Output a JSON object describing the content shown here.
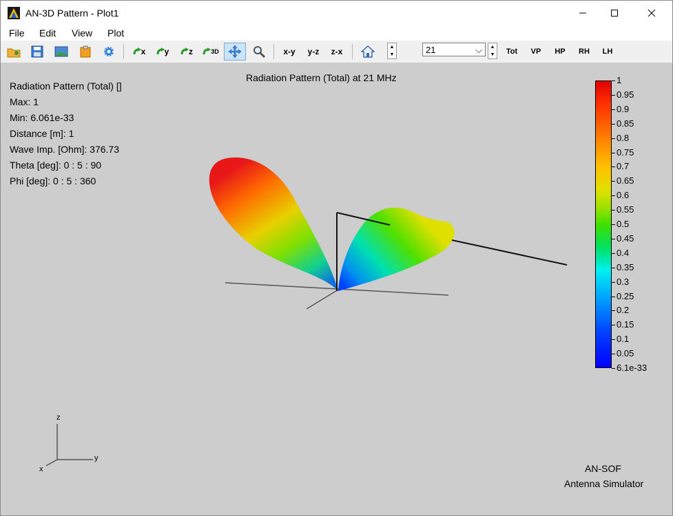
{
  "window": {
    "title": "AN-3D Pattern - Plot1"
  },
  "menu": {
    "file": "File",
    "edit": "Edit",
    "view": "View",
    "plot": "Plot"
  },
  "toolbar": {
    "rot_x": "x",
    "rot_y": "y",
    "rot_z": "z",
    "rot_3d": "3D",
    "view_xy": "x-y",
    "view_yz": "y-z",
    "view_zx": "z-x",
    "freq_value": "21",
    "tot": "Tot",
    "vp": "VP",
    "hp": "HP",
    "rh": "RH",
    "lh": "LH"
  },
  "plot": {
    "title": "Radiation Pattern (Total) at 21 MHz",
    "info": [
      "Radiation Pattern (Total) []",
      "Max: 1",
      "Min: 6.061e-33",
      "Distance [m]: 1",
      "Wave Imp. [Ohm]: 376.73",
      "Theta [deg]: 0 : 5 : 90",
      "Phi [deg]: 0 : 5 : 360"
    ],
    "colorbar": [
      "1",
      "0.95",
      "0.9",
      "0.85",
      "0.8",
      "0.75",
      "0.7",
      "0.65",
      "0.6",
      "0.55",
      "0.5",
      "0.45",
      "0.4",
      "0.35",
      "0.3",
      "0.25",
      "0.2",
      "0.15",
      "0.1",
      "0.05",
      "6.1e-33"
    ],
    "brand_line1": "AN-SOF",
    "brand_line2": "Antenna Simulator",
    "axis_z": "z",
    "axis_y": "y",
    "axis_x": "x"
  }
}
